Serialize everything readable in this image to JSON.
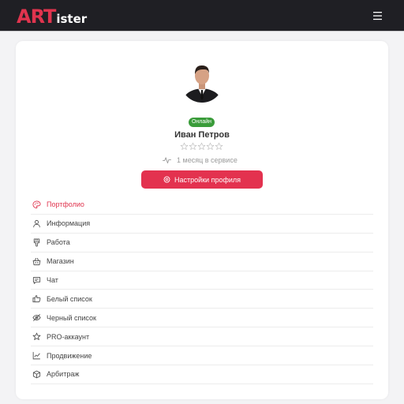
{
  "header": {
    "logo_big": "ART",
    "logo_small": "ister",
    "menu_icon": "hamburger-icon"
  },
  "profile": {
    "status": "Онлайн",
    "name": "Иван Петров",
    "rating": 0,
    "rating_max": 5,
    "service_time": "1 месяц в сервисе",
    "settings_button": "Настройки профиля"
  },
  "colors": {
    "accent": "#e3324f",
    "online": "#3a9c3a",
    "header_bg": "#1f1f24"
  },
  "menu": {
    "items": [
      {
        "label": "Портфолио",
        "icon": "palette-icon",
        "active": true
      },
      {
        "label": "Информация",
        "icon": "user-icon",
        "active": false
      },
      {
        "label": "Работа",
        "icon": "brush-icon",
        "active": false
      },
      {
        "label": "Магазин",
        "icon": "basket-icon",
        "active": false
      },
      {
        "label": "Чат",
        "icon": "chat-icon",
        "active": false
      },
      {
        "label": "Белый список",
        "icon": "thumbs-up-icon",
        "active": false
      },
      {
        "label": "Черный список",
        "icon": "eye-slash-icon",
        "active": false
      },
      {
        "label": "PRO-аккаунт",
        "icon": "star-icon",
        "active": false
      },
      {
        "label": "Продвижение",
        "icon": "chart-line-icon",
        "active": false
      },
      {
        "label": "Арбитраж",
        "icon": "box-icon",
        "active": false
      }
    ]
  }
}
